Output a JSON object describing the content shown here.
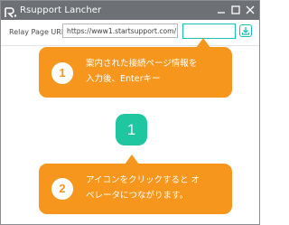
{
  "window": {
    "title": "Rsupport Lancher",
    "icons": {
      "app": "rsupport-logo-icon",
      "minimize": "minimize-icon",
      "maximize": "maximize-icon",
      "close": "close-icon"
    },
    "titlebar_color": "#6d7074"
  },
  "connection": {
    "label": "Relay Page URL",
    "url_value": "https://www1.startsupport.com/",
    "key_value": "",
    "go_icon": "download-arrow-icon",
    "accent_color": "#19c1b1"
  },
  "callouts": [
    {
      "step": "1",
      "lines": [
        "案内された接続ページ情報を",
        "入力後、Enterキー"
      ]
    },
    {
      "step": "2",
      "lines": [
        "アイコンをクリックすると オ",
        "ペレータにつながります。"
      ]
    }
  ],
  "callout_color": "#f7961d",
  "operator": {
    "label": "1",
    "color": "#1ec7a0"
  }
}
